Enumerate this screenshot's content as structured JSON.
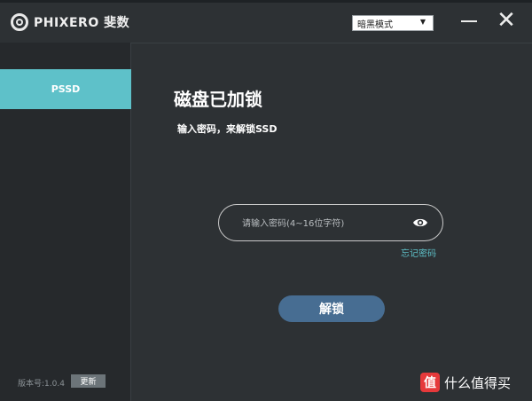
{
  "app": {
    "brand": "PHIXERO 斐数"
  },
  "header": {
    "theme_select_value": "暗黑模式"
  },
  "sidebar": {
    "items": [
      {
        "label": "PSSD"
      }
    ],
    "version_text": "版本号:1.0.4",
    "update_label": "更新"
  },
  "main": {
    "title": "磁盘已加锁",
    "subtitle": "输入密码，来解锁SSD",
    "password_placeholder": "请输入密码(4~16位字符)",
    "password_value": "",
    "forgot_label": "忘记密码",
    "unlock_label": "解锁"
  },
  "watermark": {
    "logo_char": "值",
    "text": "什么值得买"
  },
  "colors": {
    "background": "#2d3134",
    "sidebar": "#26292c",
    "accent": "#5ec1c9",
    "button": "#476d92"
  }
}
